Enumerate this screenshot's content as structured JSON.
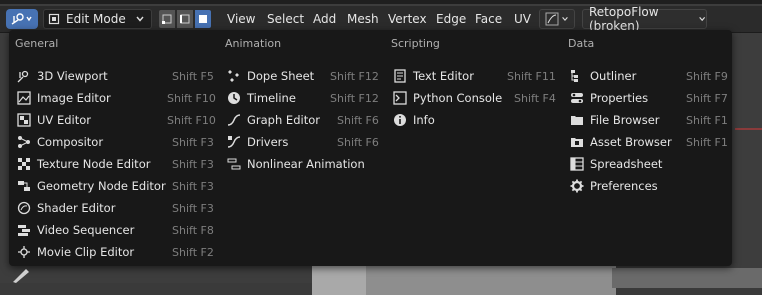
{
  "header": {
    "mode_label": "Edit Mode",
    "menu": [
      "View",
      "Select",
      "Add",
      "Mesh",
      "Vertex",
      "Edge",
      "Face",
      "UV"
    ],
    "plugin_label": "RetopoFlow (broken)"
  },
  "columns": [
    {
      "title": "General",
      "items": [
        {
          "label": "3D Viewport",
          "shortcut": "Shift F5",
          "icon": "viewport-icon"
        },
        {
          "label": "Image Editor",
          "shortcut": "Shift F10",
          "icon": "image-icon"
        },
        {
          "label": "UV Editor",
          "shortcut": "Shift F10",
          "icon": "uv-icon"
        },
        {
          "label": "Compositor",
          "shortcut": "Shift F3",
          "icon": "compositor-icon"
        },
        {
          "label": "Texture Node Editor",
          "shortcut": "Shift F3",
          "icon": "texture-node-icon"
        },
        {
          "label": "Geometry Node Editor",
          "shortcut": "Shift F3",
          "icon": "geometry-node-icon"
        },
        {
          "label": "Shader Editor",
          "shortcut": "Shift F3",
          "icon": "shader-icon"
        },
        {
          "label": "Video Sequencer",
          "shortcut": "Shift F8",
          "icon": "sequencer-icon"
        },
        {
          "label": "Movie Clip Editor",
          "shortcut": "Shift F2",
          "icon": "clip-icon"
        }
      ]
    },
    {
      "title": "Animation",
      "items": [
        {
          "label": "Dope Sheet",
          "shortcut": "Shift F12",
          "icon": "dopesheet-icon"
        },
        {
          "label": "Timeline",
          "shortcut": "Shift F12",
          "icon": "timeline-icon"
        },
        {
          "label": "Graph Editor",
          "shortcut": "Shift F6",
          "icon": "graph-icon"
        },
        {
          "label": "Drivers",
          "shortcut": "Shift F6",
          "icon": "drivers-icon"
        },
        {
          "label": "Nonlinear Animation",
          "shortcut": "",
          "icon": "nla-icon"
        }
      ]
    },
    {
      "title": "Scripting",
      "items": [
        {
          "label": "Text Editor",
          "shortcut": "Shift F11",
          "icon": "text-icon"
        },
        {
          "label": "Python Console",
          "shortcut": "Shift F4",
          "icon": "console-icon"
        },
        {
          "label": "Info",
          "shortcut": "",
          "icon": "info-icon"
        }
      ]
    },
    {
      "title": "Data",
      "items": [
        {
          "label": "Outliner",
          "shortcut": "Shift F9",
          "icon": "outliner-icon"
        },
        {
          "label": "Properties",
          "shortcut": "Shift F7",
          "icon": "properties-icon"
        },
        {
          "label": "File Browser",
          "shortcut": "Shift F1",
          "icon": "file-browser-icon"
        },
        {
          "label": "Asset Browser",
          "shortcut": "Shift F1",
          "icon": "asset-icon"
        },
        {
          "label": "Spreadsheet",
          "shortcut": "",
          "icon": "spreadsheet-icon"
        },
        {
          "label": "Preferences",
          "shortcut": "",
          "icon": "preferences-icon"
        }
      ]
    }
  ],
  "colors": {
    "accent": "#4772b3",
    "menu_bg": "#181818",
    "header_bg": "#2b2b2b"
  }
}
